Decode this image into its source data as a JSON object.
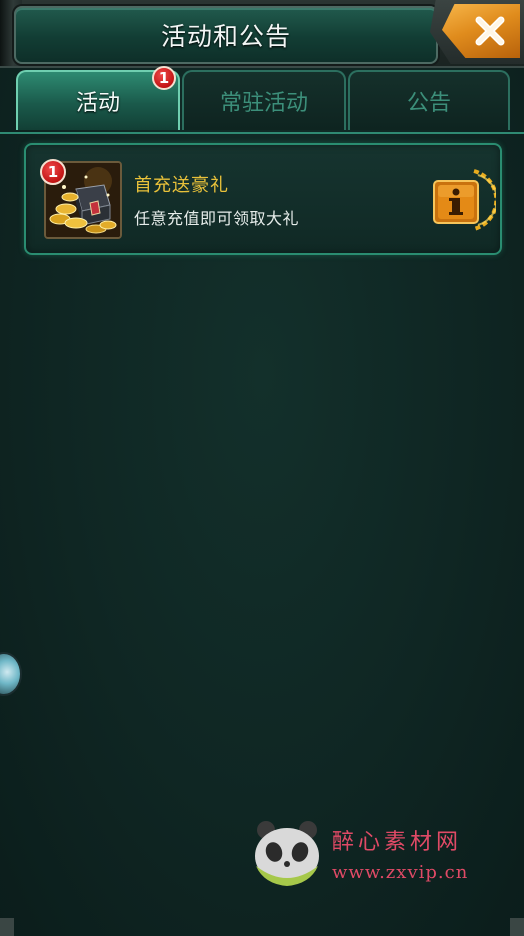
{
  "header": {
    "title": "活动和公告",
    "close_icon": "close-x-icon"
  },
  "tabs": [
    {
      "label": "活动",
      "active": true,
      "badge": "1"
    },
    {
      "label": "常驻活动",
      "active": false
    },
    {
      "label": "公告",
      "active": false
    }
  ],
  "activities": [
    {
      "badge": "1",
      "icon": "treasure-chest-icon",
      "title": "首充送豪礼",
      "description": "任意充值即可领取大礼",
      "info_icon": "info-icon"
    }
  ],
  "watermark": {
    "title": "醉心素材网",
    "url": "www.zxvip.cn"
  },
  "colors": {
    "accent_green": "#2a8d71",
    "title_gold": "#e8c13a",
    "badge_red": "#c21414",
    "close_orange": "#e08c1d"
  }
}
